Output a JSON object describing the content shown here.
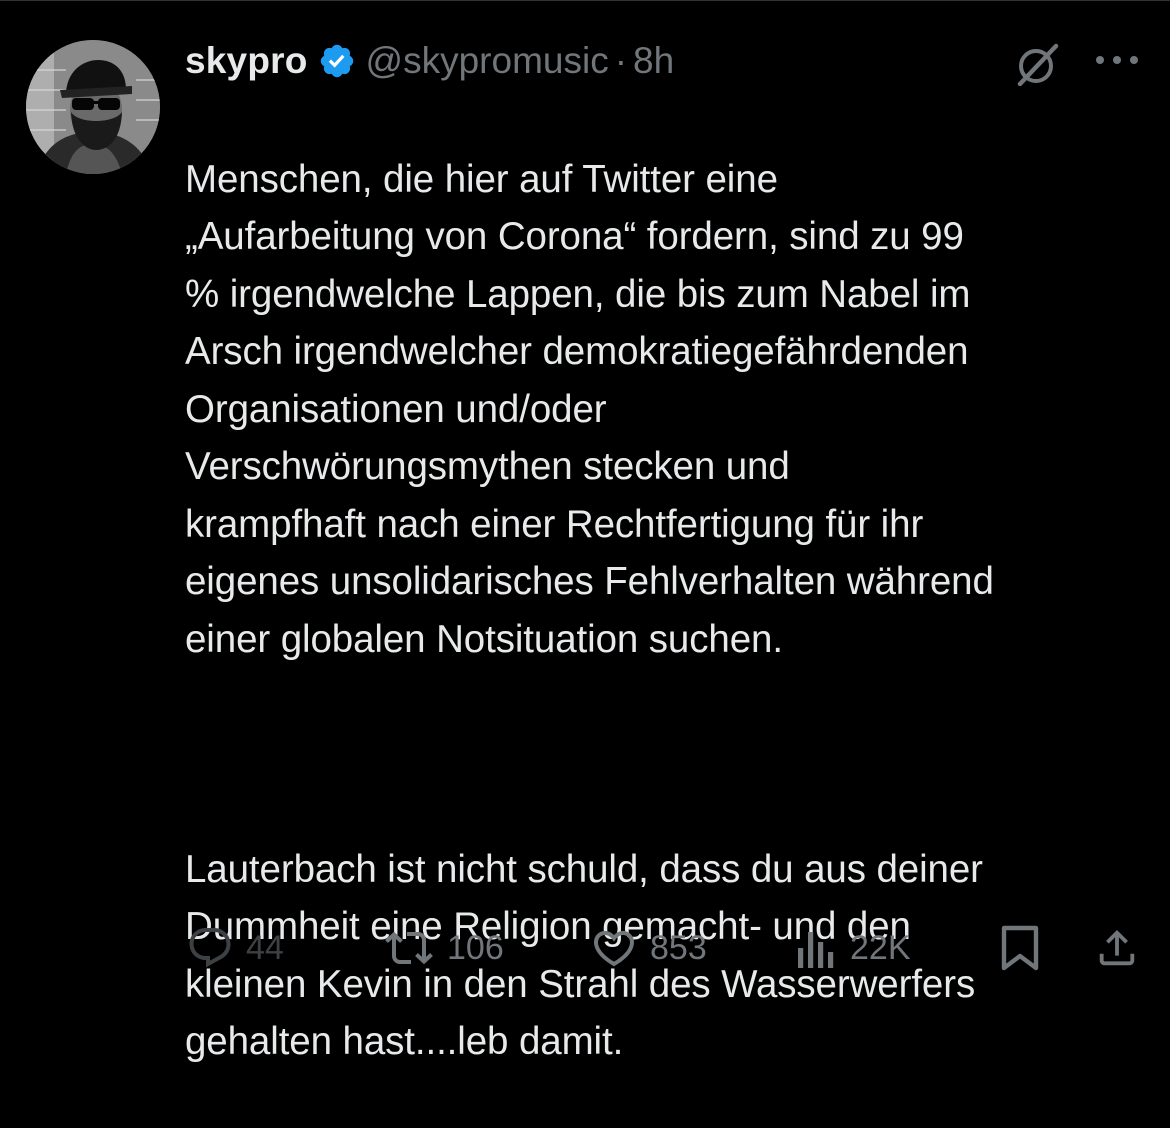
{
  "tweet": {
    "author": {
      "display_name": "skypro",
      "handle": "@skypromusic",
      "verified": true,
      "avatar_icon": "avatar-photo"
    },
    "separator": "·",
    "timestamp": "8h",
    "paragraphs": [
      "Menschen, die hier auf Twitter eine\n„Aufarbeitung von Corona“ fordern, sind zu 99\n% irgendwelche Lappen, die bis zum Nabel im\nArsch irgendwelcher demokratiegefährdenden\nOrganisationen und/oder\nVerschwörungsmythen stecken und\nkrampfhaft nach einer Rechtfertigung für ihr\neigenes unsolidarisches Fehlverhalten während\neiner globalen Notsituation suchen.",
      "Lauterbach ist nicht schuld, dass du aus deiner\nDummheit eine Religion gemacht- und den\nkleinen Kevin in den Strahl des Wasserwerfers\ngehalten hast....leb damit."
    ],
    "metrics": {
      "replies": "44",
      "retweets": "106",
      "likes": "853",
      "views": "22K"
    }
  },
  "icons": {
    "verified": "verified-badge-icon",
    "grok": "grok-icon",
    "more": "more-options-icon",
    "reply": "reply-icon",
    "retweet": "retweet-icon",
    "like": "heart-icon",
    "views": "views-chart-icon",
    "bookmark": "bookmark-icon",
    "share": "share-icon"
  },
  "colors": {
    "background": "#000000",
    "text_primary": "#e7e9ea",
    "text_secondary": "#71767b",
    "verified_blue": "#1d9bf0",
    "divider": "#2f3336"
  }
}
